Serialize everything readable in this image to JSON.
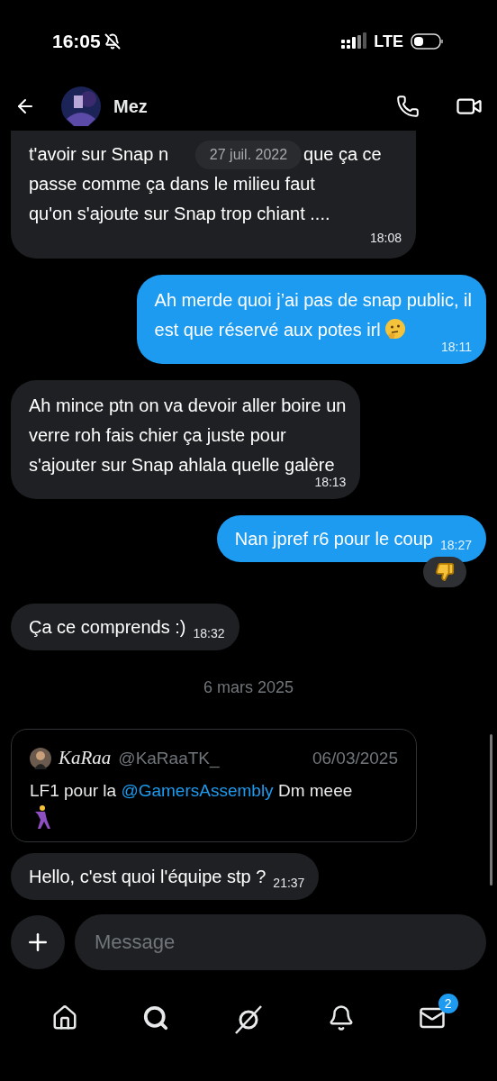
{
  "status_bar": {
    "time": "16:05",
    "network": "LTE"
  },
  "header": {
    "name": "Mez"
  },
  "date_pill": "27 juil. 2022",
  "messages": [
    {
      "kind": "clipped",
      "outgoing": false,
      "first_line": [
        "t'avoir sur Snap n",
        "que ça ce"
      ],
      "text": "passe comme ça dans le milieu faut\nqu'on s'ajoute sur Snap trop chiant ....",
      "time": "18:08",
      "reacted": false
    },
    {
      "kind": "emoji_end",
      "outgoing": true,
      "text": "Ah merde quoi j’ai pas de snap public, il\nest que réservé aux potes irl",
      "time": "18:11",
      "reacted": false
    },
    {
      "kind": "plain",
      "outgoing": false,
      "text": "Ah mince ptn on va devoir aller boire un\nverre roh fais chier ça juste pour\ns'ajouter sur Snap ahlala quelle galère",
      "time": "18:13",
      "reacted": false
    },
    {
      "kind": "inline",
      "outgoing": true,
      "text": "Nan jpref r6 pour le coup",
      "time": "18:27",
      "reacted": true
    },
    {
      "kind": "inline",
      "outgoing": false,
      "text": "Ça ce comprends :)",
      "time": "18:32",
      "reacted": false
    },
    {
      "kind": "date",
      "text": "6 mars 2025"
    },
    {
      "kind": "quote",
      "author": "KaRaa",
      "handle": "@KaRaaTK_",
      "date": "06/03/2025",
      "text_before": "LF1 pour la",
      "mention": "@GamersAssembly",
      "text_after": "Dm meee"
    },
    {
      "kind": "inline",
      "outgoing": false,
      "text": "Hello, c'est quoi l'équipe stp ?",
      "time": "21:37",
      "reacted": false
    }
  ],
  "composer": {
    "placeholder": "Message"
  },
  "nav": {
    "badge": "2"
  }
}
